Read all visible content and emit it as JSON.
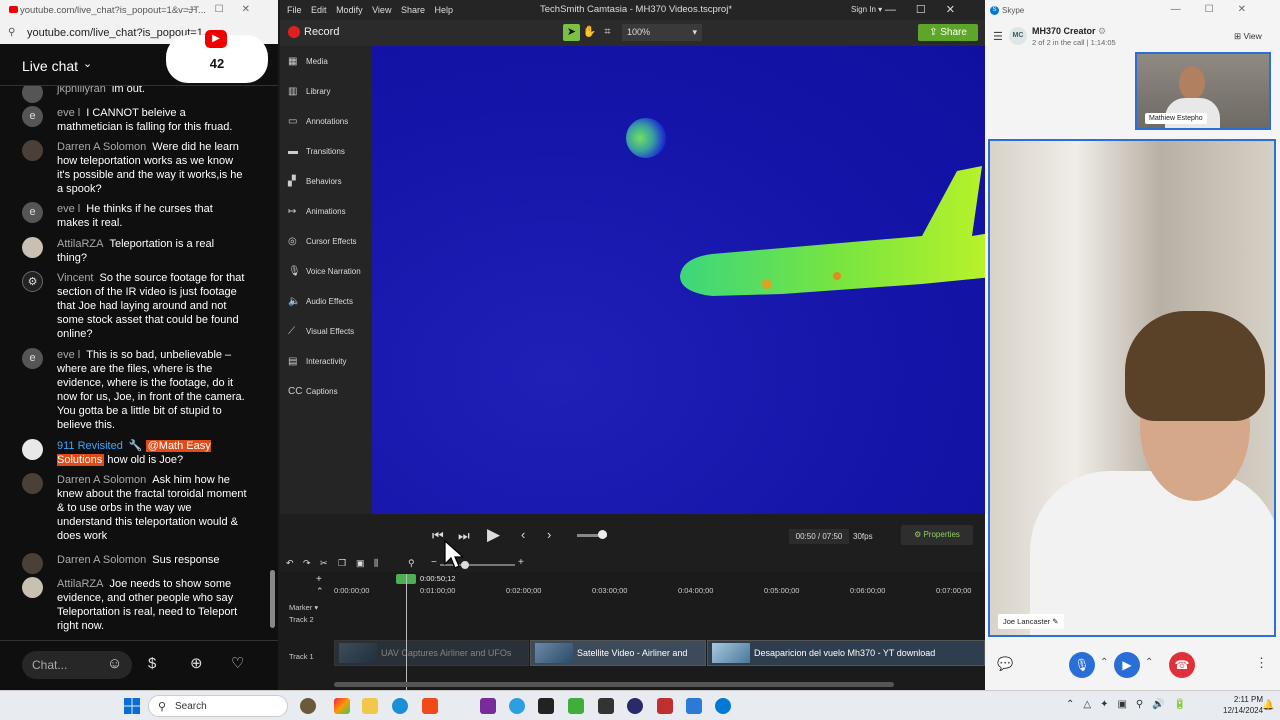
{
  "youtube": {
    "tab_title": "youtube.com/live_chat?is_popout=1&v=JT...",
    "url": "youtube.com/live_chat?is_popout=1...",
    "header_title": "Live chat",
    "viewer_count": "42",
    "chat_placeholder": "Chat...",
    "messages": [
      {
        "author": "jkpnillyran",
        "text": "im out.",
        "avatar": ""
      },
      {
        "author": "eve l",
        "text": "I CANNOT beleive a mathmetician is falling for this fruad.",
        "avatar": "e"
      },
      {
        "author": "Darren A Solomon",
        "text": "Were did he learn how teleportation works as we know it's possible and the way it works,is he a spook?",
        "avatar": ""
      },
      {
        "author": "eve l",
        "text": "He thinks if he curses that makes it real.",
        "avatar": "e"
      },
      {
        "author": "AttilaRZA",
        "text": "Teleportation is a real thing?",
        "avatar": ""
      },
      {
        "author": "Vincent",
        "text": "So the source footage for that section of the IR video is just footage that Joe had laying around and not some stock asset that could be found online?",
        "avatar": "⚙"
      },
      {
        "author": "eve l",
        "text": "This is so bad, unbelievable – where are the files, where is the evidence, where is the footage, do it now for us, Joe, in front of the camera. You gotta be a little bit of stupid to believe this.",
        "avatar": "e"
      },
      {
        "author": "911 Revisited",
        "mention": "@Math Easy Solutions",
        "text": "how old is Joe?",
        "avatar": ""
      },
      {
        "author": "Darren A Solomon",
        "text": "Ask him how he knew about the fractal toroidal moment & to use orbs in the way we understand this teleportation would & does work",
        "avatar": ""
      },
      {
        "author": "Darren A Solomon",
        "text": "Sus response",
        "avatar": ""
      },
      {
        "author": "AttilaRZA",
        "text": "Joe needs to show some evidence, and other people who say Teleportation is real, need to Teleport right now.",
        "avatar": ""
      }
    ]
  },
  "camtasia": {
    "menu": [
      "File",
      "Edit",
      "Modify",
      "View",
      "Share",
      "Help"
    ],
    "title": "TechSmith Camtasia - MH370 Videos.tscproj*",
    "sign_in": "Sign In ▾",
    "record_label": "Record",
    "zoom": "100%",
    "share_label": "Share",
    "sidebar": [
      "Media",
      "Library",
      "Annotations",
      "Transitions",
      "Behaviors",
      "Animations",
      "Cursor Effects",
      "Voice Narration",
      "Audio Effects",
      "Visual Effects",
      "Interactivity",
      "Captions"
    ],
    "time": "00:50 / 07:50",
    "fps": "30fps",
    "properties_label": "Properties",
    "playhead_time": "0:00:50;12",
    "ruler": [
      "0:00:00;00",
      "0:01:00;00",
      "0:02:00;00",
      "0:03:00;00",
      "0:04:00;00",
      "0:05:00;00",
      "0:06:00;00",
      "0:07:00;00"
    ],
    "marker_label": "Marker",
    "track2": "Track 2",
    "track1": "Track 1",
    "clips": [
      "UAV Captures Airliner and UFOs",
      "Satellite Video - Airliner and",
      "Desaparicion del vuelo Mh370 - YT download"
    ]
  },
  "skype": {
    "app_title": "Skype",
    "call_name": "MH370 Creator",
    "call_sub": "2 of 2 in the call | 1:14:05",
    "view_label": "View",
    "thumb_name": "Mathiew Estepho",
    "main_name": "Joe Lancaster"
  },
  "taskbar": {
    "search_label": "Search",
    "time": "2:11 PM",
    "date": "12/14/2024"
  },
  "colors": {
    "skype_blue": "#0078d4",
    "camtasia_green": "#5ea629",
    "record_red": "#e02020",
    "hangup_red": "#e0303a"
  }
}
